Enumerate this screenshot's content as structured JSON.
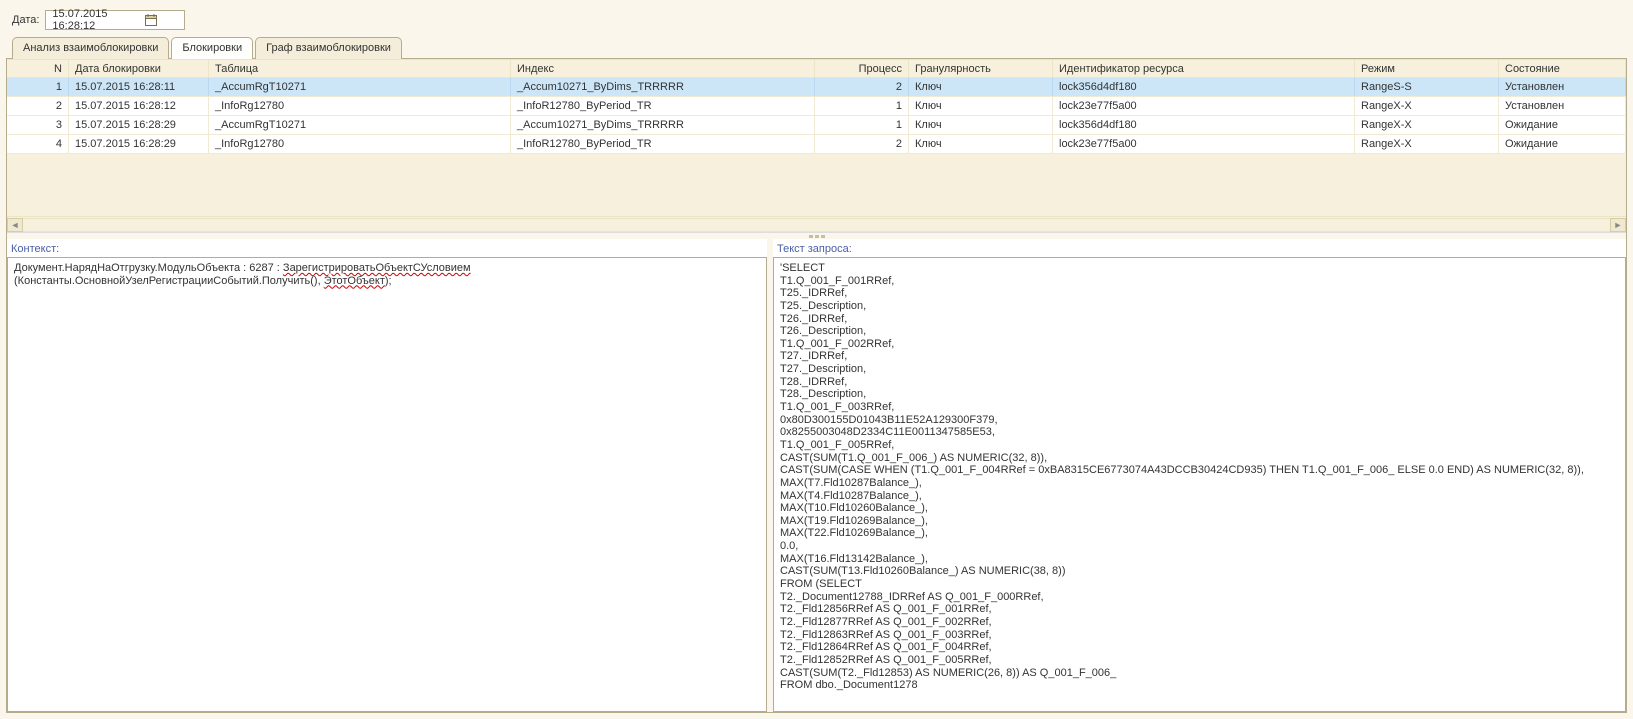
{
  "dateRow": {
    "label": "Дата:",
    "value": "15.07.2015 16:28:12"
  },
  "tabs": {
    "analysis": "Анализ взаимоблокировки",
    "locks": "Блокировки",
    "graph": "Граф взаимоблокировки"
  },
  "grid": {
    "headers": {
      "n": "N",
      "date": "Дата блокировки",
      "table": "Таблица",
      "index": "Индекс",
      "process": "Процесс",
      "granularity": "Гранулярность",
      "resource": "Идентификатор ресурса",
      "mode": "Режим",
      "state": "Состояние"
    },
    "rows": [
      {
        "n": "1",
        "date": "15.07.2015 16:28:11",
        "table": "_AccumRgT10271",
        "index": "_Accum10271_ByDims_TRRRRR",
        "process": "2",
        "granularity": "Ключ",
        "resource": "lock356d4df180",
        "mode": "RangeS-S",
        "state": "Установлен"
      },
      {
        "n": "2",
        "date": "15.07.2015 16:28:12",
        "table": "_InfoRg12780",
        "index": "_InfoR12780_ByPeriod_TR",
        "process": "1",
        "granularity": "Ключ",
        "resource": "lock23e77f5a00",
        "mode": "RangeX-X",
        "state": "Установлен"
      },
      {
        "n": "3",
        "date": "15.07.2015 16:28:29",
        "table": "_AccumRgT10271",
        "index": "_Accum10271_ByDims_TRRRRR",
        "process": "1",
        "granularity": "Ключ",
        "resource": "lock356d4df180",
        "mode": "RangeX-X",
        "state": "Ожидание"
      },
      {
        "n": "4",
        "date": "15.07.2015 16:28:29",
        "table": "_InfoRg12780",
        "index": "_InfoR12780_ByPeriod_TR",
        "process": "2",
        "granularity": "Ключ",
        "resource": "lock23e77f5a00",
        "mode": "RangeX-X",
        "state": "Ожидание"
      }
    ]
  },
  "panes": {
    "contextLabel": "Контекст:",
    "queryLabel": "Текст запроса:",
    "contextParts": {
      "p1": "Документ.НарядНаОтгрузку.МодульОбъекта : 6287 : ",
      "p2": "ЗарегистрироватьОбъектСУсловием",
      "p3": " (Константы.ОсновнойУзелРегистрацииСобытий.Получить(), ",
      "p4": "ЭтотОбъект",
      "p5": ");"
    },
    "queryText": "'SELECT\nT1.Q_001_F_001RRef,\nT25._IDRRef,\nT25._Description,\nT26._IDRRef,\nT26._Description,\nT1.Q_001_F_002RRef,\nT27._IDRRef,\nT27._Description,\nT28._IDRRef,\nT28._Description,\nT1.Q_001_F_003RRef,\n0x80D300155D01043B11E52A129300F379,\n0x8255003048D2334C11E0011347585E53,\nT1.Q_001_F_005RRef,\nCAST(SUM(T1.Q_001_F_006_) AS NUMERIC(32, 8)),\nCAST(SUM(CASE WHEN (T1.Q_001_F_004RRef = 0xBA8315CE6773074A43DCCB30424CD935) THEN T1.Q_001_F_006_ ELSE 0.0 END) AS NUMERIC(32, 8)),\nMAX(T7.Fld10287Balance_),\nMAX(T4.Fld10287Balance_),\nMAX(T10.Fld10260Balance_),\nMAX(T19.Fld10269Balance_),\nMAX(T22.Fld10269Balance_),\n0.0,\nMAX(T16.Fld13142Balance_),\nCAST(SUM(T13.Fld10260Balance_) AS NUMERIC(38, 8))\nFROM (SELECT\nT2._Document12788_IDRRef AS Q_001_F_000RRef,\nT2._Fld12856RRef AS Q_001_F_001RRef,\nT2._Fld12877RRef AS Q_001_F_002RRef,\nT2._Fld12863RRef AS Q_001_F_003RRef,\nT2._Fld12864RRef AS Q_001_F_004RRef,\nT2._Fld12852RRef AS Q_001_F_005RRef,\nCAST(SUM(T2._Fld12853) AS NUMERIC(26, 8)) AS Q_001_F_006_\nFROM dbo._Document1278"
  }
}
